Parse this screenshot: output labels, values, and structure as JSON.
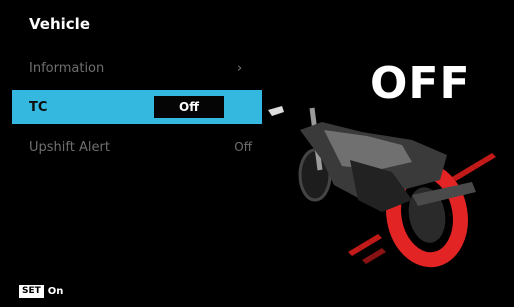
{
  "screen": {
    "title": "Vehicle"
  },
  "menu": {
    "items": [
      {
        "label": "Information",
        "icon": "chevron-right-icon",
        "chevron": "›"
      },
      {
        "label": "TC",
        "value": "Off",
        "selected": true
      },
      {
        "label": "Upshift Alert",
        "value": "Off"
      }
    ]
  },
  "status": {
    "big_text": "OFF"
  },
  "footer": {
    "badge": "SET",
    "text": "On"
  },
  "colors": {
    "accent": "#35b8e0",
    "warning": "#e02020",
    "background": "#000000"
  }
}
